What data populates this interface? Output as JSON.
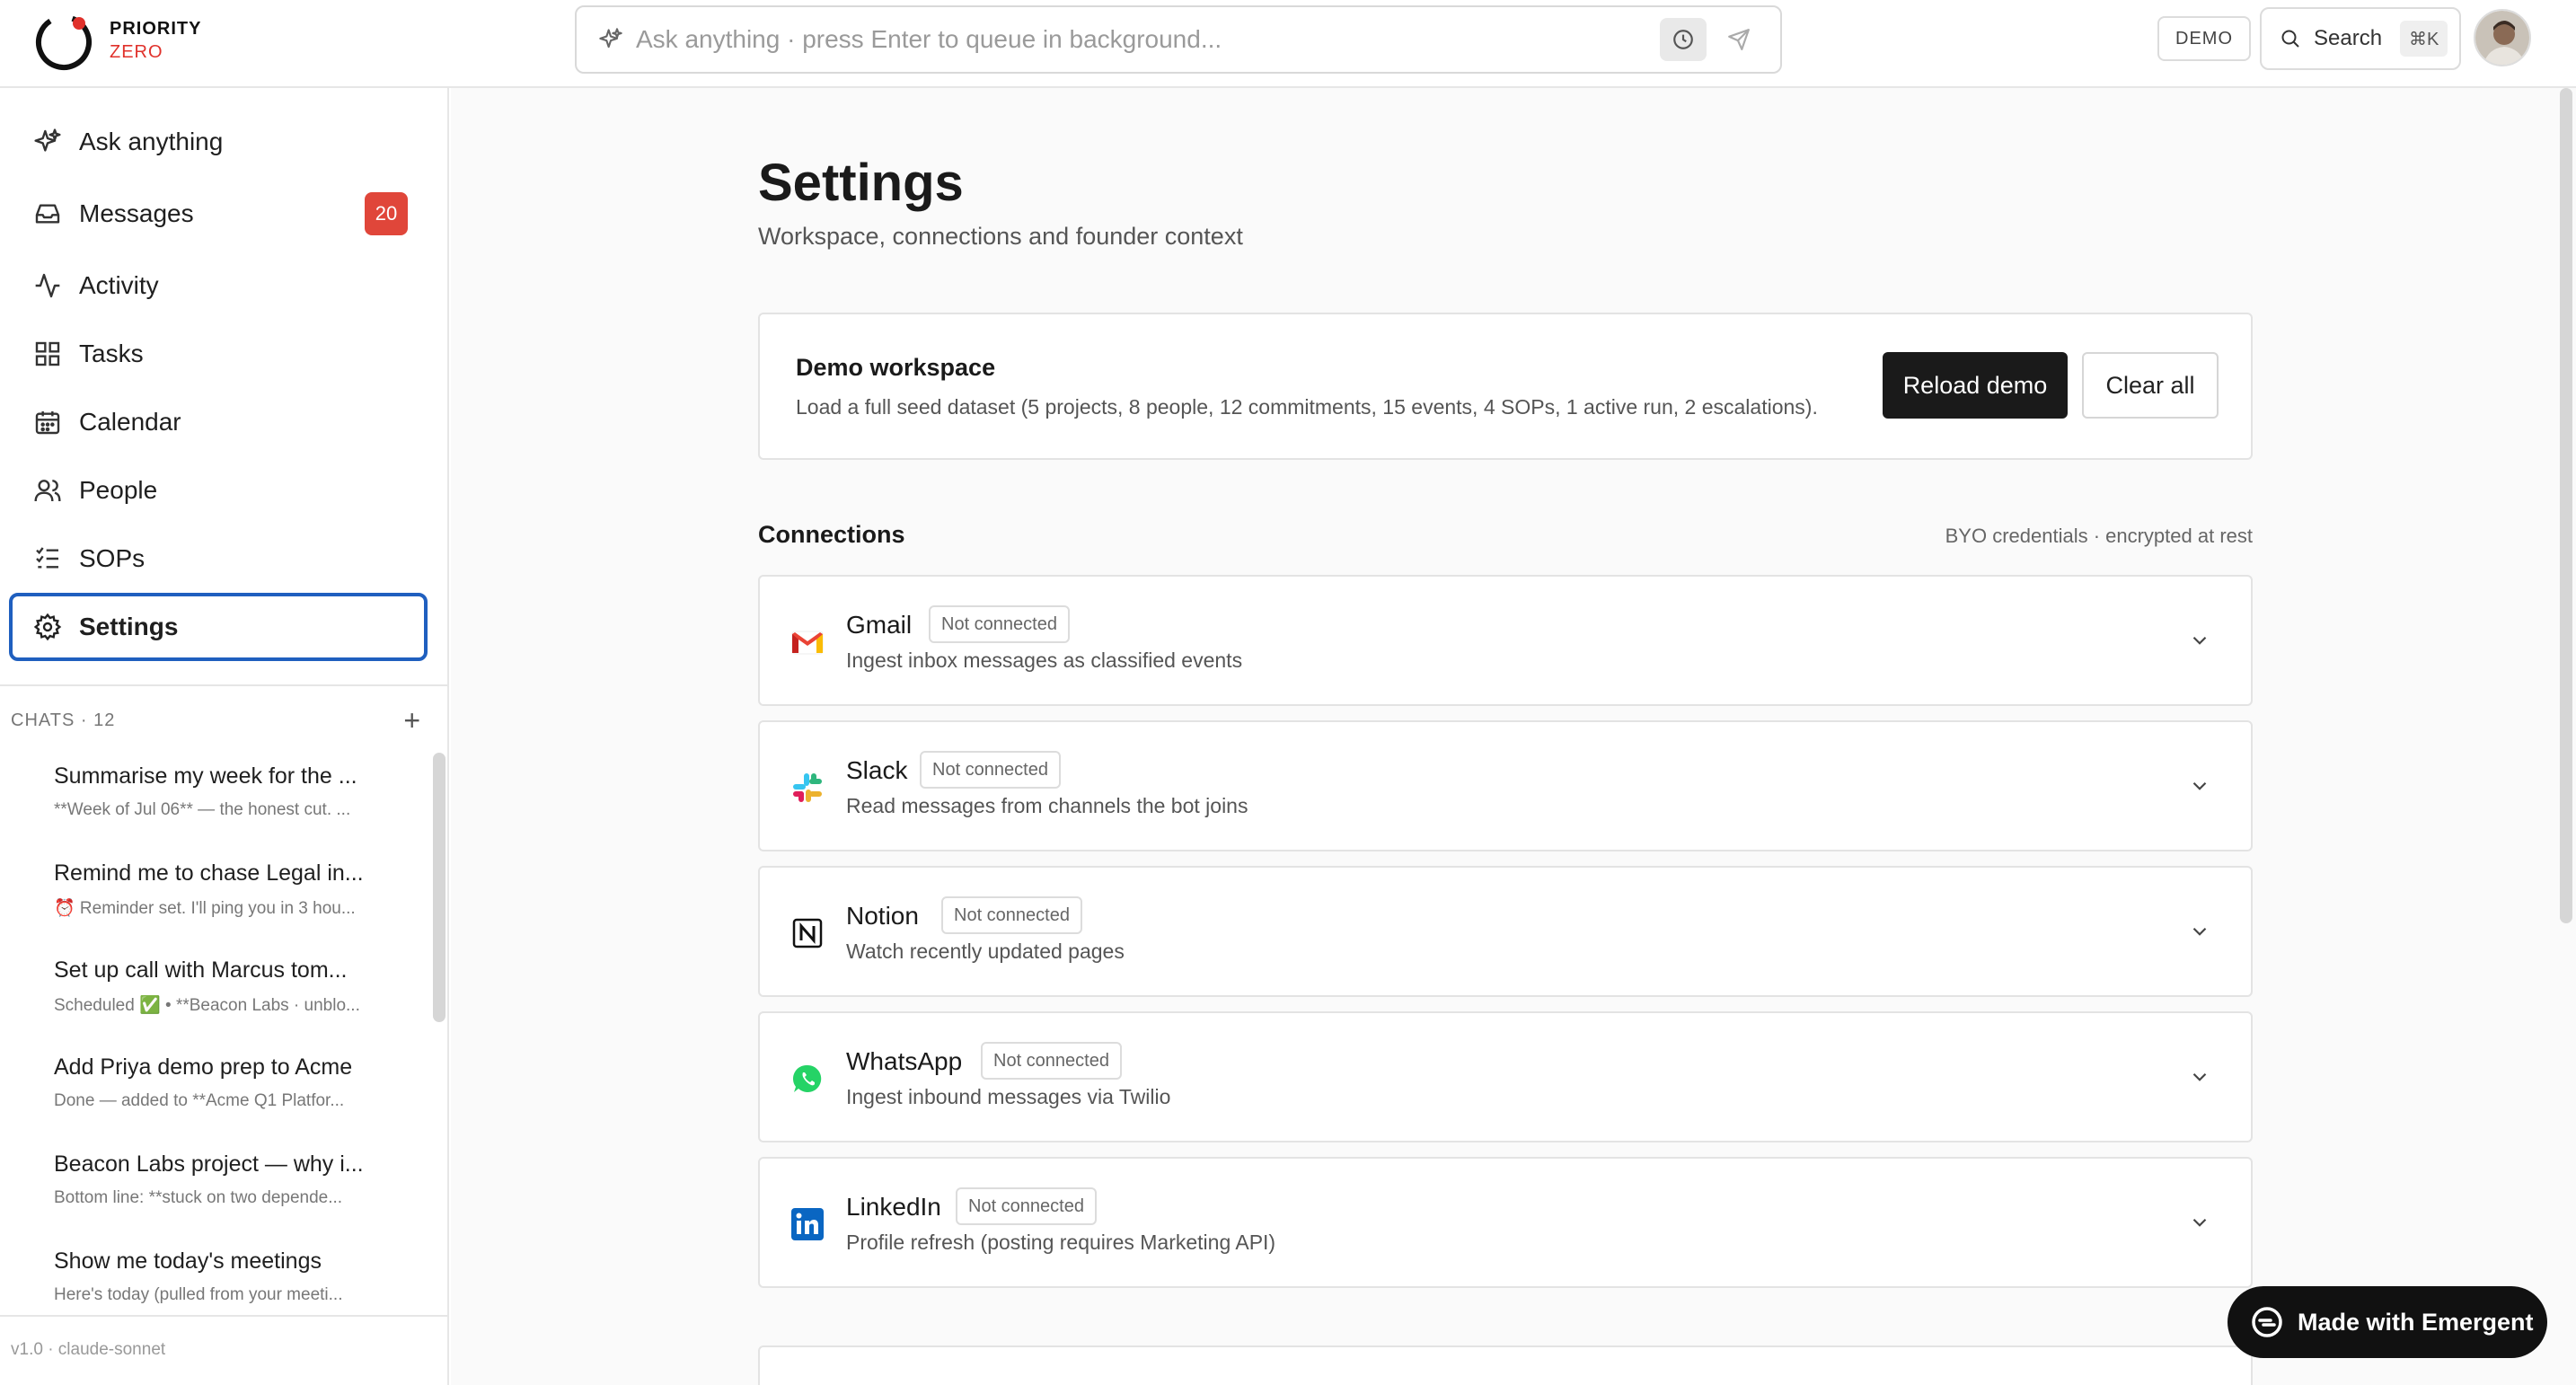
{
  "brand": {
    "line1": "PRIORITY",
    "line2": "ZERO",
    "accent": "#e0312b"
  },
  "ask_bar": {
    "placeholder": "Ask anything · press Enter to queue in background..."
  },
  "header": {
    "demo_badge": "DEMO",
    "search_label": "Search",
    "search_shortcut": "⌘K"
  },
  "sidebar": {
    "items": [
      {
        "label": "Ask anything",
        "icon": "sparkle-icon"
      },
      {
        "label": "Messages",
        "icon": "inbox-icon",
        "badge": "20"
      },
      {
        "label": "Activity",
        "icon": "activity-icon"
      },
      {
        "label": "Tasks",
        "icon": "grid-icon"
      },
      {
        "label": "Calendar",
        "icon": "calendar-icon"
      },
      {
        "label": "People",
        "icon": "people-icon"
      },
      {
        "label": "SOPs",
        "icon": "checklist-icon"
      },
      {
        "label": "Settings",
        "icon": "gear-icon",
        "active": true
      }
    ],
    "chats_title": "CHATS · 12",
    "chats": [
      {
        "title": "Summarise my week for the ...",
        "snippet": "**Week of Jul 06** — the honest cut. ..."
      },
      {
        "title": "Remind me to chase Legal in...",
        "snippet": "⏰ Reminder set. I'll ping you in 3 hou..."
      },
      {
        "title": "Set up call with Marcus tom...",
        "snippet": "Scheduled ✅ • **Beacon Labs · unblo..."
      },
      {
        "title": "Add Priya demo prep to Acme",
        "snippet": "Done — added to **Acme Q1 Platfor..."
      },
      {
        "title": "Beacon Labs project — why i...",
        "snippet": "Bottom line: **stuck on two depende..."
      },
      {
        "title": "Show me today's meetings",
        "snippet": "Here's today (pulled from your meeti..."
      }
    ],
    "version": "v1.0 · claude-sonnet"
  },
  "main": {
    "title": "Settings",
    "subtitle": "Workspace, connections and founder context",
    "demo": {
      "heading": "Demo workspace",
      "description": "Load a full seed dataset (5 projects, 8 people, 12 commitments, 15 events, 4 SOPs, 1 active run, 2 escalations).",
      "reload_label": "Reload demo",
      "clear_label": "Clear all"
    },
    "connections_title": "Connections",
    "connections_note": "BYO credentials · encrypted at rest",
    "connections": [
      {
        "name": "Gmail",
        "status": "Not connected",
        "description": "Ingest inbox messages as classified events",
        "icon": "gmail-icon"
      },
      {
        "name": "Slack",
        "status": "Not connected",
        "description": "Read messages from channels the bot joins",
        "icon": "slack-icon"
      },
      {
        "name": "Notion",
        "status": "Not connected",
        "description": "Watch recently updated pages",
        "icon": "notion-icon"
      },
      {
        "name": "WhatsApp",
        "status": "Not connected",
        "description": "Ingest inbound messages via Twilio",
        "icon": "whatsapp-icon"
      },
      {
        "name": "LinkedIn",
        "status": "Not connected",
        "description": "Profile refresh (posting requires Marketing API)",
        "icon": "linkedin-icon"
      }
    ]
  },
  "emergent_badge": "Made with Emergent"
}
